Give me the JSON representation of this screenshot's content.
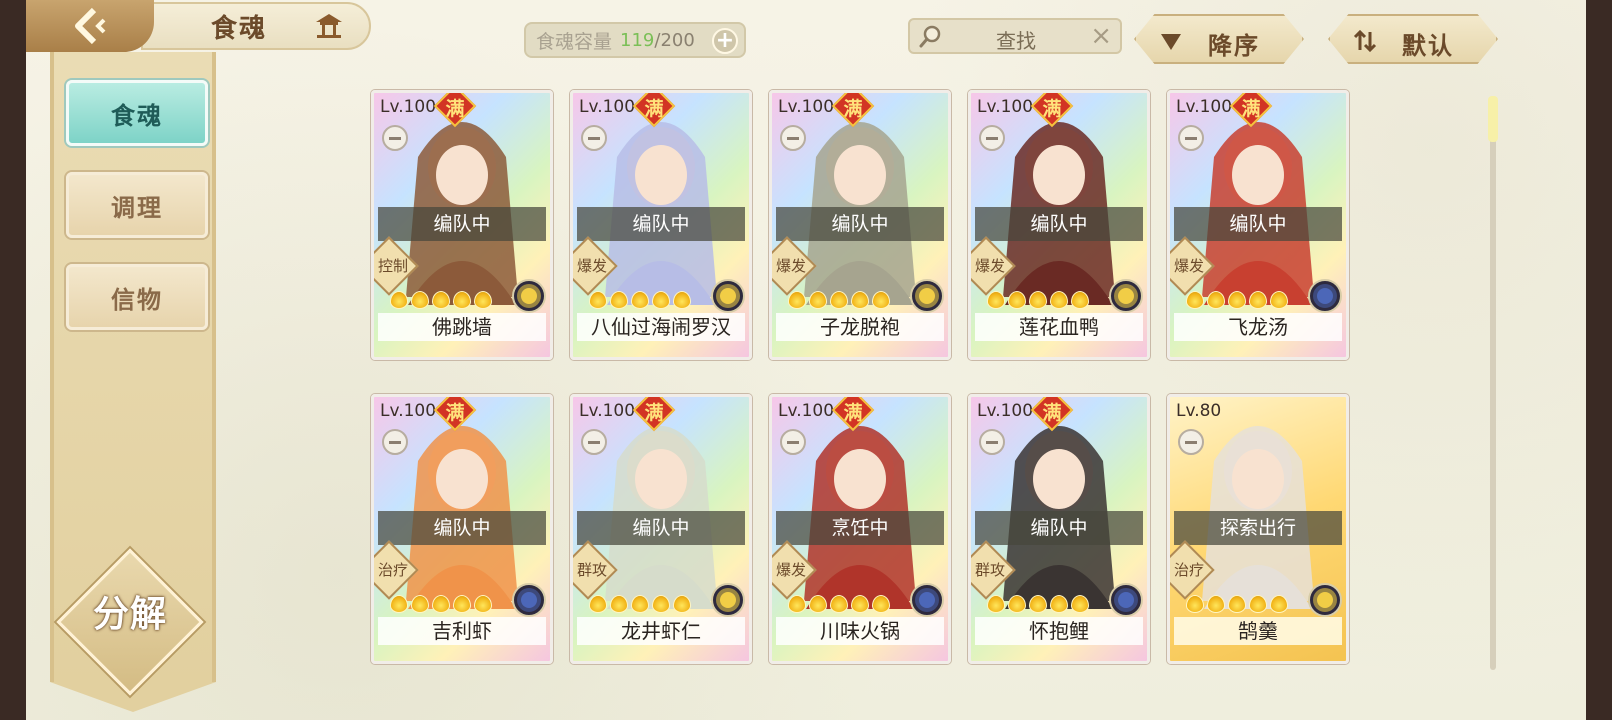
{
  "header": {
    "title": "食魂",
    "capacity": {
      "label": "食魂容量",
      "current": "119",
      "separator": "/",
      "max": "200",
      "add_label": "+"
    },
    "search": {
      "text": "查找",
      "clear_label": "×"
    },
    "sort_order_label": "降序",
    "sort_mode_label": "默认"
  },
  "sidebar": {
    "items": [
      {
        "label": "食魂",
        "active": true
      },
      {
        "label": "调理",
        "active": false
      },
      {
        "label": "信物",
        "active": false
      }
    ],
    "decompose_label": "分解"
  },
  "cards": [
    {
      "level": "Lv.100",
      "maxed": true,
      "full_label": "满",
      "status": "编队中",
      "role": "控制",
      "stars": 5,
      "element": "gold",
      "name": "佛跳墙",
      "art": "#8c5a3a"
    },
    {
      "level": "Lv.100",
      "maxed": true,
      "full_label": "满",
      "status": "编队中",
      "role": "爆发",
      "stars": 5,
      "element": "gold",
      "name": "八仙过海闹罗汉",
      "art": "#b7bde6"
    },
    {
      "level": "Lv.100",
      "maxed": true,
      "full_label": "满",
      "status": "编队中",
      "role": "爆发",
      "stars": 5,
      "element": "gold",
      "name": "子龙脱袍",
      "art": "#a6a48f"
    },
    {
      "level": "Lv.100",
      "maxed": true,
      "full_label": "满",
      "status": "编队中",
      "role": "爆发",
      "stars": 5,
      "element": "gold",
      "name": "莲花血鸭",
      "art": "#6a2a24"
    },
    {
      "level": "Lv.100",
      "maxed": true,
      "full_label": "满",
      "status": "编队中",
      "role": "爆发",
      "stars": 5,
      "element": "blue",
      "name": "飞龙汤",
      "art": "#c84030"
    },
    {
      "level": "Lv.100",
      "maxed": true,
      "full_label": "满",
      "status": "编队中",
      "role": "治疗",
      "stars": 5,
      "element": "blue",
      "name": "吉利虾",
      "art": "#f0934a"
    },
    {
      "level": "Lv.100",
      "maxed": true,
      "full_label": "满",
      "status": "编队中",
      "role": "群攻",
      "stars": 5,
      "element": "gold",
      "name": "龙井虾仁",
      "art": "#d6dccb"
    },
    {
      "level": "Lv.100",
      "maxed": true,
      "full_label": "满",
      "status": "烹饪中",
      "role": "爆发",
      "stars": 5,
      "element": "blue",
      "name": "川味火锅",
      "art": "#b0342a"
    },
    {
      "level": "Lv.100",
      "maxed": true,
      "full_label": "满",
      "status": "编队中",
      "role": "群攻",
      "stars": 5,
      "element": "blue",
      "name": "怀抱鲤",
      "art": "#3a3432"
    },
    {
      "level": "Lv.80",
      "maxed": false,
      "full_label": "",
      "status": "探索出行",
      "role": "治疗",
      "stars": 5,
      "element": "gold",
      "name": "鹄羹",
      "art": "#e6e0d8"
    }
  ]
}
